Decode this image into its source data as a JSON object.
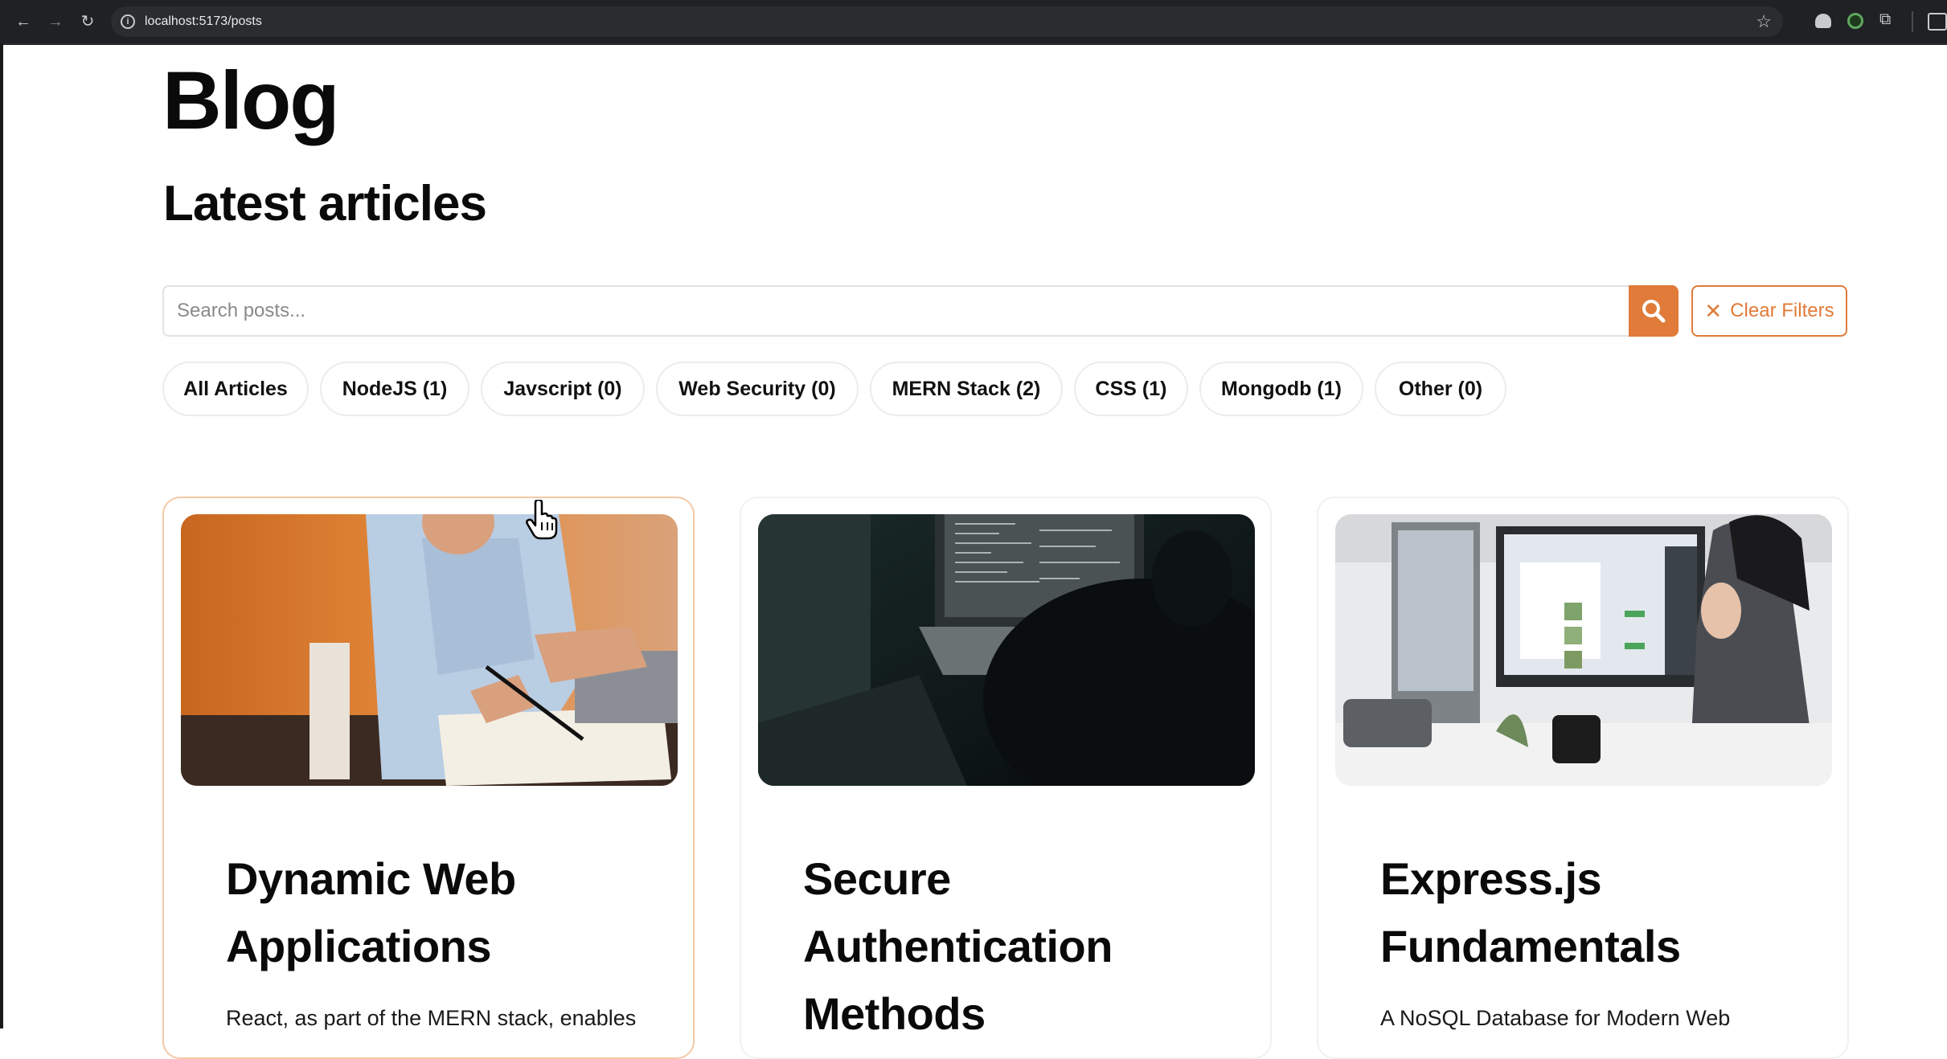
{
  "browser": {
    "url": "localhost:5173/posts"
  },
  "page": {
    "title": "Blog",
    "section_title": "Latest articles"
  },
  "search": {
    "placeholder": "Search posts...",
    "clear_label": "Clear Filters"
  },
  "filters": [
    "All Articles",
    "NodeJS (1)",
    "Javscript (0)",
    "Web Security (0)",
    "MERN Stack (2)",
    "CSS (1)",
    "Mongodb (1)",
    "Other (0)"
  ],
  "posts": [
    {
      "title": "Dynamic Web Applications",
      "excerpt": "React, as part of the MERN stack, enables"
    },
    {
      "title": "Secure Authentication Methods",
      "excerpt": ""
    },
    {
      "title": "Express.js Fundamentals",
      "excerpt": "A NoSQL Database for Modern Web"
    }
  ],
  "colors": {
    "accent": "#e07b39"
  }
}
